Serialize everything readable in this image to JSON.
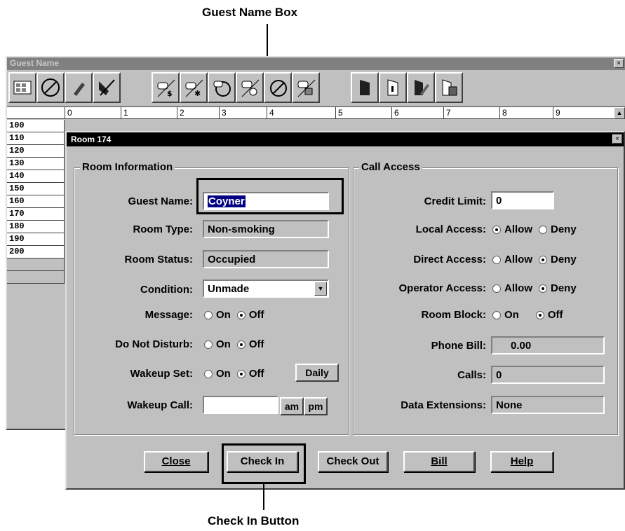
{
  "callouts": {
    "top": "Guest Name Box",
    "bottom": "Check In Button"
  },
  "bg_window": {
    "title": "Guest Name",
    "close": "×",
    "toolbar_icons": [
      "room-grid-icon",
      "no-sign-icon",
      "pencil-icon",
      "broom-icon",
      "phone-dollar-icon",
      "phone-star-icon",
      "phone-no-icon",
      "phone-alarm-icon",
      "phone-no2-icon",
      "phone-cancel-icon",
      "door-icon",
      "door-open-icon",
      "door-pencil-icon",
      "door-block-icon"
    ],
    "ruler": [
      "0",
      "1",
      "2",
      "3",
      "4",
      "5",
      "6",
      "7",
      "8",
      "9"
    ],
    "ruler_scroll": "▲",
    "rooms": [
      "100",
      "110",
      "120",
      "130",
      "140",
      "150",
      "160",
      "170",
      "180",
      "190",
      "200",
      "",
      ""
    ]
  },
  "dialog": {
    "title": "Room 174",
    "close": "×",
    "room_info": {
      "group_label": "Room Information",
      "guest_name_label": "Guest Name:",
      "guest_name_value": "Coyner",
      "room_type_label": "Room Type:",
      "room_type_value": "Non-smoking",
      "room_status_label": "Room Status:",
      "room_status_value": "Occupied",
      "condition_label": "Condition:",
      "condition_value": "Unmade",
      "message_label": "Message:",
      "dnd_label": "Do Not Disturb:",
      "wakeup_set_label": "Wakeup Set:",
      "wakeup_call_label": "Wakeup Call:",
      "on": "On",
      "off": "Off",
      "daily": "Daily",
      "am": "am",
      "pm": "pm"
    },
    "call_access": {
      "group_label": "Call Access",
      "credit_limit_label": "Credit Limit:",
      "credit_limit_value": "0",
      "local_access_label": "Local Access:",
      "direct_access_label": "Direct Access:",
      "operator_access_label": "Operator Access:",
      "room_block_label": "Room Block:",
      "phone_bill_label": "Phone Bill:",
      "phone_bill_value": "0.00",
      "calls_label": "Calls:",
      "calls_value": "0",
      "data_ext_label": "Data Extensions:",
      "data_ext_value": "None",
      "allow": "Allow",
      "deny": "Deny",
      "on": "On",
      "off": "Off"
    },
    "buttons": {
      "close": "Close",
      "check_in": "Check In",
      "check_out": "Check Out",
      "bill": "Bill",
      "help": "Help"
    }
  }
}
